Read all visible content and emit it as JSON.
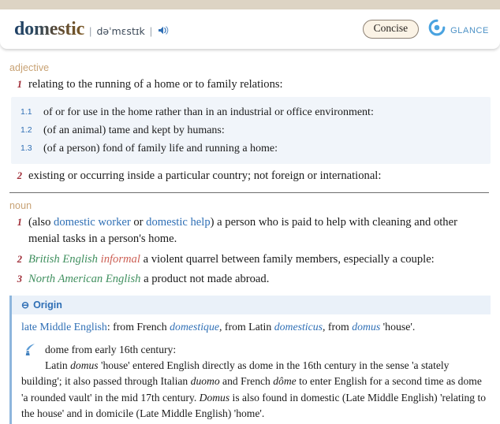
{
  "header": {
    "headword": "domestic",
    "separator": "|",
    "phonetic": "dəˈmɛstɪk",
    "audio_icon": "speaker-icon",
    "concise_label": "Concise",
    "brand_name": "GLANCE",
    "brand_icon": "glance-logo-icon",
    "accent_blue": "#4d92c6",
    "strip_color": "#ddd4c4"
  },
  "entry": {
    "parts": [
      {
        "pos": "adjective",
        "senses": [
          {
            "num": "1",
            "text": "relating to the running of a home or to family relations:",
            "subsenses": [
              {
                "num": "1.1",
                "text": "of or for use in the home rather than in an industrial or office environment:"
              },
              {
                "num": "1.2",
                "text": "(of an animal) tame and kept by humans:"
              },
              {
                "num": "1.3",
                "text": "(of a person) fond of family life and running a home:"
              }
            ]
          },
          {
            "num": "2",
            "text": "existing or occurring inside a particular country; not foreign or international:",
            "subsenses": []
          }
        ]
      },
      {
        "pos": "noun",
        "senses": [
          {
            "num": "1",
            "prefix_open": "(also ",
            "link1": "domestic worker",
            "conj": " or ",
            "link2": "domestic help",
            "prefix_close": ") ",
            "text": "a person who is paid to help with cleaning and other menial tasks in a person's home.",
            "subsenses": []
          },
          {
            "num": "2",
            "region": "British English",
            "style": "informal",
            "text": "a violent quarrel between family members, especially a couple:",
            "subsenses": []
          },
          {
            "num": "3",
            "region": "North American English",
            "style": "",
            "text": "a product not made abroad.",
            "subsenses": []
          }
        ]
      }
    ]
  },
  "origin": {
    "collapse_glyph": "⊖",
    "title": "Origin",
    "etymology": {
      "lead": "late Middle English",
      "part1": ": from French ",
      "word1": "domestique",
      "part2": ", from Latin ",
      "word2": "domesticus",
      "part3": ", from ",
      "word3": "domus",
      "part4": " 'house'."
    },
    "note": {
      "icon": "quill-icon",
      "headword": "dome",
      "heading_rest": " from early 16th century:",
      "body_a1": "Latin ",
      "body_a2": "domus",
      "body_a3": " 'house' entered English directly as dome in the 16th century in the sense 'a stately building'; it also passed through Italian ",
      "body_a4": "duomo",
      "body_a5": " and French ",
      "body_a6": "dôme",
      "body_a7": " to enter English for a second time as dome 'a rounded vault' in the mid 17th century. ",
      "body_a8": "Domus",
      "body_a9": " is also found in ",
      "body_a10": "domestic",
      "body_a11": " (Late Middle English) 'relating to the house' and in ",
      "body_a12": "domicile",
      "body_a13": " (Late Middle English) 'home'."
    }
  }
}
